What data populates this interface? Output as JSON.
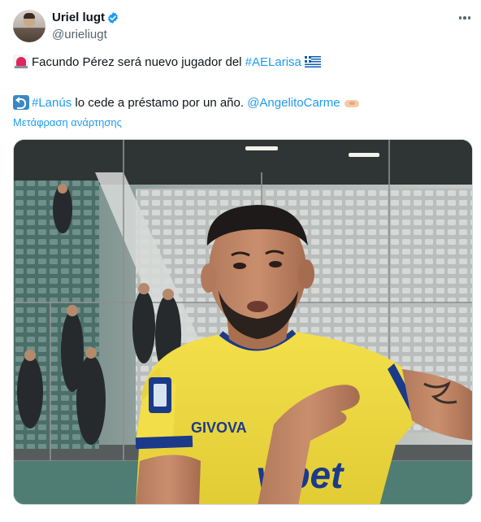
{
  "author": {
    "display_name": "Uriel lugt",
    "handle": "@urieliugt",
    "verified": true,
    "avatar_icon": "profile-photo"
  },
  "tweet": {
    "line1": {
      "prefix_icon": "police-light-emoji",
      "text": "Facundo Pérez será nuevo jugador del ",
      "hashtag": "#AELarisa",
      "suffix_icon": "greece-flag-emoji"
    },
    "line2": {
      "prefix_icon": "leftwards-arrow-emoji",
      "hashtag": "#Lanús",
      "text": " lo cede a préstamo por un año. ",
      "mention": "@AngelitoCarme",
      "suffix_icon": "handshake-emoji"
    },
    "translate_link": "Μετάφραση ανάρτησης"
  },
  "media": {
    "type": "photo",
    "jersey_sponsor": "vibet",
    "jersey_brand": "GIVOVA"
  },
  "colors": {
    "link": "#1d9bf0",
    "verified": "#1d9bf0",
    "secondary_text": "#536471",
    "jersey_yellow": "#f4e04d",
    "jersey_blue": "#1b3a8a"
  }
}
